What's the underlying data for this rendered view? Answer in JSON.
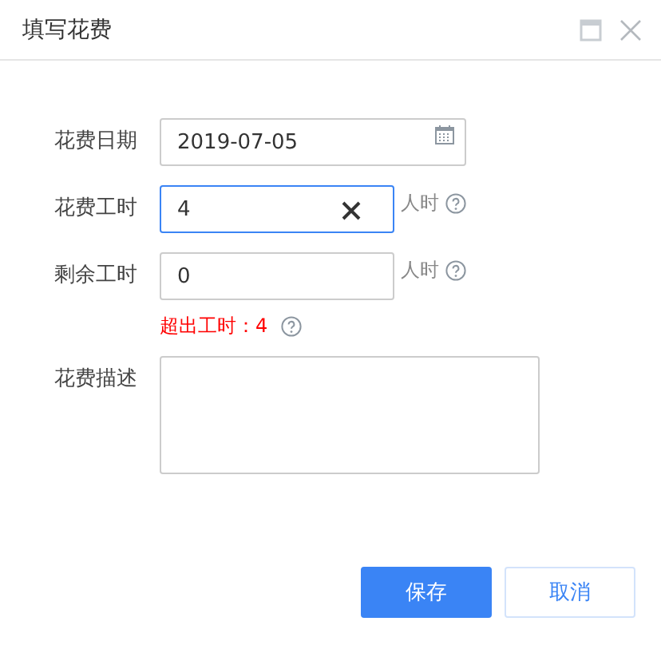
{
  "window": {
    "title": "填写花费"
  },
  "fields": [
    {
      "kind": "date",
      "label": "花费日期",
      "value": "2019-07-05",
      "focused": false
    },
    {
      "kind": "number",
      "label": "花费工时",
      "value": "4",
      "focused": true,
      "unit": "人时",
      "clearable": true
    },
    {
      "kind": "number",
      "label": "剩余工时",
      "value": "0",
      "focused": false,
      "unit": "人时"
    },
    {
      "kind": "warning",
      "text": "超出工时：4"
    },
    {
      "kind": "textarea",
      "label": "花费描述",
      "focused": false
    }
  ],
  "buttons": [
    {
      "label": "保存",
      "primary": true
    },
    {
      "label": "取消",
      "primary": false
    }
  ]
}
